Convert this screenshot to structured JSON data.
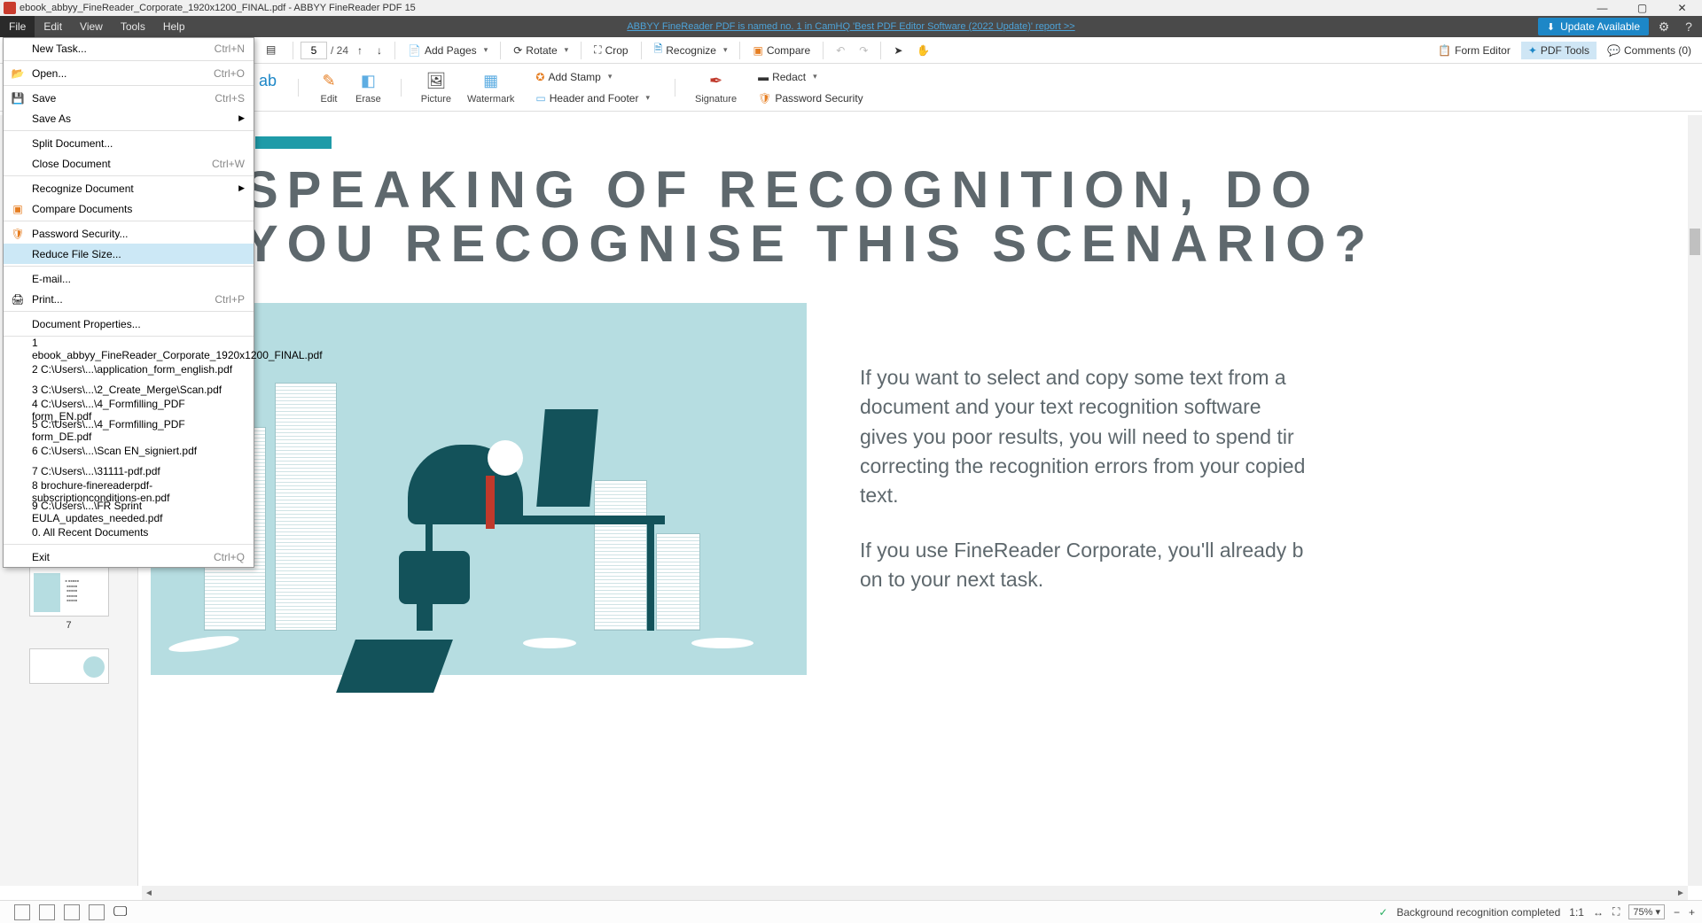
{
  "title": "ebook_abbyy_FineReader_Corporate_1920x1200_FINAL.pdf - ABBYY FineReader PDF 15",
  "menubar": [
    "File",
    "Edit",
    "View",
    "Tools",
    "Help"
  ],
  "promo": "ABBYY FineReader PDF is named no. 1 in CamHQ 'Best PDF Editor Software (2022 Update)' report >>",
  "update_label": "Update Available",
  "toolbar1": {
    "page_current": "5",
    "page_total": "/ 24",
    "add_pages": "Add Pages",
    "rotate": "Rotate",
    "crop": "Crop",
    "recognize": "Recognize",
    "compare": "Compare",
    "form_editor": "Form Editor",
    "pdf_tools": "PDF Tools",
    "comments": "Comments (0)"
  },
  "toolbar2": {
    "edit": "Edit",
    "erase": "Erase",
    "picture": "Picture",
    "watermark": "Watermark",
    "add_stamp": "Add Stamp",
    "header_footer": "Header and Footer",
    "signature": "Signature",
    "redact": "Redact",
    "password_security": "Password Security"
  },
  "file_menu": {
    "new_task": {
      "label": "New Task...",
      "sc": "Ctrl+N"
    },
    "open": {
      "label": "Open...",
      "sc": "Ctrl+O"
    },
    "save": {
      "label": "Save",
      "sc": "Ctrl+S"
    },
    "save_as": {
      "label": "Save As"
    },
    "split": {
      "label": "Split Document..."
    },
    "close": {
      "label": "Close Document",
      "sc": "Ctrl+W"
    },
    "recognize_doc": {
      "label": "Recognize Document"
    },
    "compare_docs": {
      "label": "Compare Documents"
    },
    "password_sec": {
      "label": "Password Security..."
    },
    "reduce": {
      "label": "Reduce File Size..."
    },
    "email": {
      "label": "E-mail..."
    },
    "print": {
      "label": "Print...",
      "sc": "Ctrl+P"
    },
    "doc_props": {
      "label": "Document Properties..."
    },
    "recent": [
      "1 ebook_abbyy_FineReader_Corporate_1920x1200_FINAL.pdf",
      "2 C:\\Users\\...\\application_form_english.pdf",
      "3 C:\\Users\\...\\2_Create_Merge\\Scan.pdf",
      "4 C:\\Users\\...\\4_Formfilling_PDF form_EN.pdf",
      "5 C:\\Users\\...\\4_Formfilling_PDF form_DE.pdf",
      "6 C:\\Users\\...\\Scan EN_signiert.pdf",
      "7 C:\\Users\\...\\31111-pdf.pdf",
      "8 brochure-finereaderpdf-subscriptionconditions-en.pdf",
      "9 C:\\Users\\...\\FR Sprint EULA_updates_needed.pdf"
    ],
    "all_recent": "0. All Recent Documents",
    "exit": {
      "label": "Exit",
      "sc": "Ctrl+Q"
    }
  },
  "document": {
    "heading": "SPEAKING OF RECOGNITION, DO YOU RECOGNISE THIS SCENARIO?",
    "para1": "If you want to select and copy some text from a document and your text recognition software gives you poor results, you will need to spend tir correcting the recognition errors from your copied text.",
    "para2": "If you use FineReader Corporate, you'll already b on to your next task."
  },
  "thumb_label": "7",
  "status": {
    "recognition": "Background recognition completed",
    "scale": "1:1",
    "zoom": "75%"
  }
}
